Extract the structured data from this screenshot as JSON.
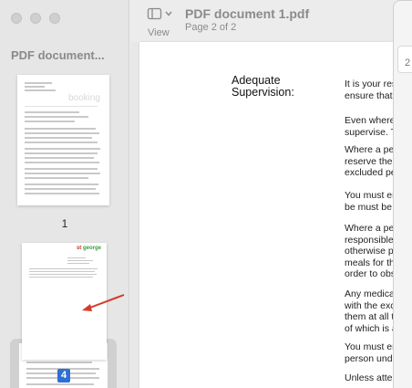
{
  "sidebar": {
    "title": "PDF document...",
    "thumb1_watermark": "booking",
    "thumb1_page_number": "1",
    "thumb2_logo_prefix": "st",
    "thumb2_logo_name": "george",
    "selected_badge": "4"
  },
  "toolbar": {
    "view_label": "View",
    "doc_title": "PDF document 1.pdf",
    "doc_subtitle": "Page 2 of 2"
  },
  "side_panel": {
    "text": "2"
  },
  "document": {
    "heading_line1": "Adequate",
    "heading_line2": "Supervision:",
    "paragraphs": [
      [
        "It is your res",
        "ensure that"
      ],
      [
        "Even where",
        "supervise. T"
      ],
      [
        "Where a pers",
        "reserve the r",
        "excluded pe"
      ],
      [
        "You must en",
        "be must be invo"
      ],
      [
        "Where a pers",
        "responsible",
        "otherwise pe",
        "meals for tha",
        "order to obse"
      ],
      [
        "Any medicati",
        "with the exce",
        "them at all ti",
        "of which is a"
      ],
      [
        "You must en",
        "person unde"
      ],
      [
        "Unless atten"
      ]
    ]
  },
  "colors": {
    "accent": "#2f6fd3",
    "annotation_arrow": "#d63a2a"
  }
}
